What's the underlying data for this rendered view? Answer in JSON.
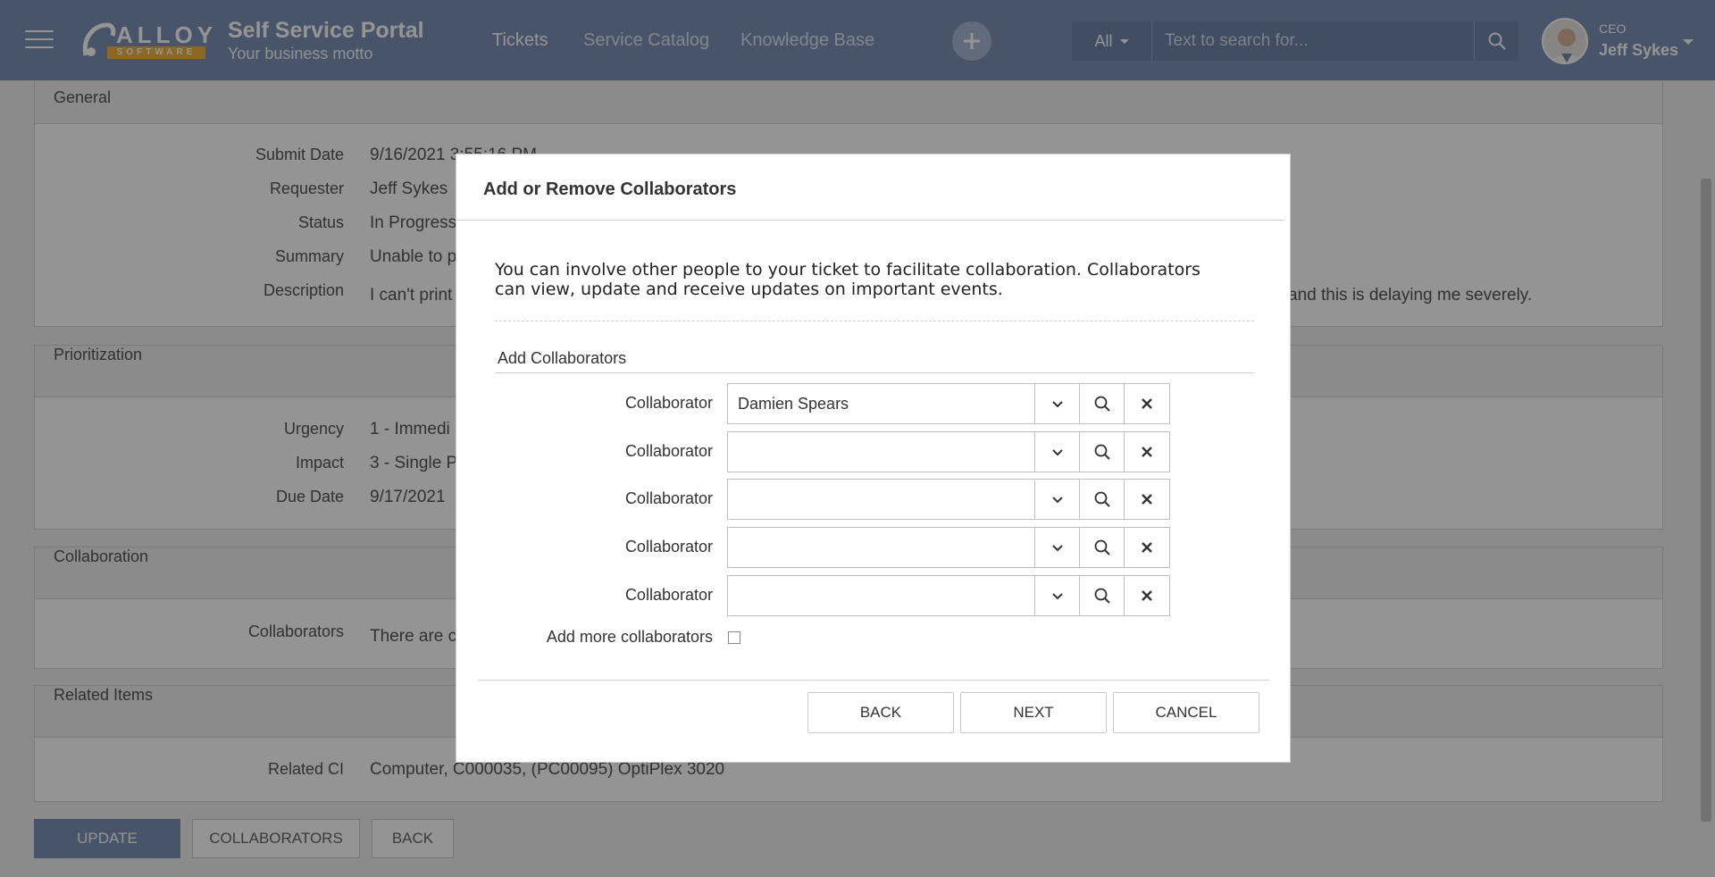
{
  "header": {
    "logo_text": "ALLOY",
    "logo_subtext": "SOFTWARE",
    "portal_title": "Self Service Portal",
    "motto": "Your business motto",
    "nav": [
      {
        "label": "Tickets",
        "active": true
      },
      {
        "label": "Service Catalog",
        "active": false
      },
      {
        "label": "Knowledge Base",
        "active": false
      }
    ],
    "search_scope": "All",
    "search_placeholder": "Text to search for...",
    "user_role": "CEO",
    "user_name": "Jeff Sykes"
  },
  "page": {
    "general": {
      "heading": "General",
      "fields": [
        {
          "label": "Submit Date",
          "value": "9/16/2021 3:55:16 PM"
        },
        {
          "label": "Requester",
          "value": "Jeff Sykes"
        },
        {
          "label": "Status",
          "value": "In Progress"
        },
        {
          "label": "Summary",
          "value": "Unable to p"
        },
        {
          "label": "Description",
          "value": "I can't print"
        }
      ],
      "description_tail": "and this is delaying me severely."
    },
    "prioritization": {
      "heading": "Prioritization",
      "fields": [
        {
          "label": "Urgency",
          "value": "1 - Immedi"
        },
        {
          "label": "Impact",
          "value": "3 - Single P"
        },
        {
          "label": "Due Date",
          "value": "9/17/2021"
        }
      ]
    },
    "collaboration": {
      "heading": "Collaboration",
      "label": "Collaborators",
      "value": "There are c"
    },
    "related": {
      "heading": "Related Items",
      "label": "Related CI",
      "value": "Computer, C000035, (PC00095) OptiPlex 3020"
    },
    "buttons": {
      "update": "UPDATE",
      "collaborators": "COLLABORATORS",
      "back": "BACK"
    }
  },
  "modal": {
    "title": "Add or Remove Collaborators",
    "description": "You can involve other people to your ticket to facilitate collaboration. Collaborators can view, update and receive updates on important events.",
    "section_title": "Add Collaborators",
    "collaborators": [
      {
        "label": "Collaborator",
        "value": "Damien Spears"
      },
      {
        "label": "Collaborator",
        "value": ""
      },
      {
        "label": "Collaborator",
        "value": ""
      },
      {
        "label": "Collaborator",
        "value": ""
      },
      {
        "label": "Collaborator",
        "value": ""
      }
    ],
    "add_more_label": "Add more collaborators",
    "add_more_checked": false,
    "buttons": {
      "back": "BACK",
      "next": "NEXT",
      "cancel": "CANCEL"
    }
  },
  "icons": {
    "menu": "hamburger-icon",
    "add": "plus-icon",
    "search": "search-icon",
    "dropdown": "chevron-down-icon",
    "clear": "close-icon"
  },
  "colors": {
    "header_bg": "#7d92b5",
    "primary_button": "#7d92b5",
    "logo_accent": "#f2b33d"
  }
}
